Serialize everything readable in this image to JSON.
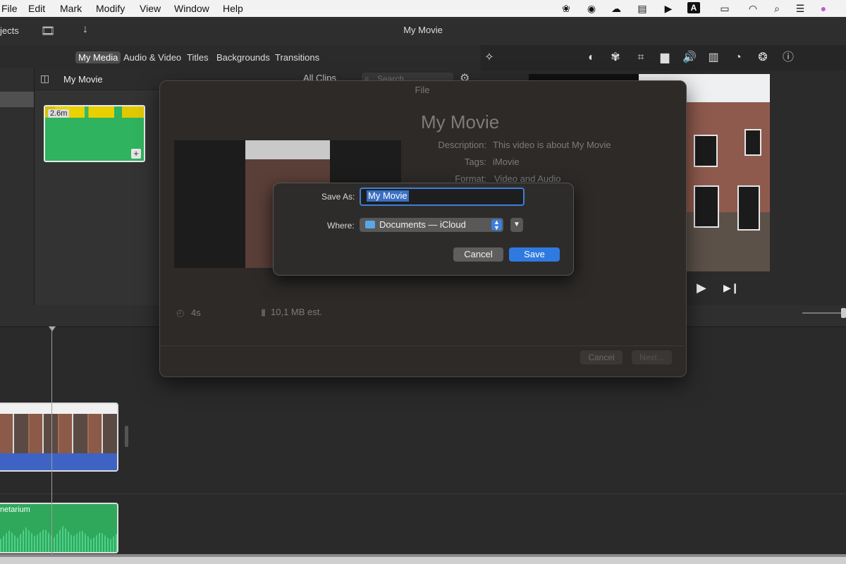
{
  "menubar": {
    "items": [
      "File",
      "Edit",
      "Mark",
      "Modify",
      "View",
      "Window",
      "Help"
    ],
    "tray_icons": [
      "lotus-icon",
      "record-icon",
      "creative-cloud-icon",
      "drive-icon",
      "play-circle-icon",
      "input-source-icon",
      "battery-icon",
      "wifi-icon",
      "search-icon",
      "control-center-icon",
      "siri-icon"
    ],
    "input_source_letter": "A"
  },
  "toolbar": {
    "projects_label": "jects",
    "window_title": "My Movie"
  },
  "browser_tabs": [
    "My Media",
    "Audio & Video",
    "Titles",
    "Backgrounds",
    "Transitions"
  ],
  "browser": {
    "title": "My Movie",
    "filter_label": "All Clips",
    "search_placeholder": "Search",
    "clip_duration": "2.6m"
  },
  "inspector_icons": [
    "magic-wand-icon",
    "color-balance-icon",
    "color-palette-icon",
    "crop-icon",
    "stabilization-icon",
    "volume-icon",
    "equalizer-icon",
    "speed-icon",
    "overlay-icon",
    "info-icon"
  ],
  "timeline": {
    "audio_clip_label": "netarium"
  },
  "share_sheet": {
    "title": "File",
    "movie_title": "My Movie",
    "description_label": "Description:",
    "description_value": "This video is about My Movie",
    "tags_label": "Tags:",
    "tags_value": "iMovie",
    "format_label": "Format:",
    "format_value": "Video and Audio",
    "duration": "4s",
    "size": "10,1 MB est.",
    "cancel_label": "Cancel",
    "next_label": "Next..."
  },
  "save_dialog": {
    "save_as_label": "Save As:",
    "save_as_value": "My Movie",
    "where_label": "Where:",
    "where_value": "Documents — iCloud",
    "cancel_label": "Cancel",
    "save_label": "Save"
  },
  "colors": {
    "accent": "#2f7ae0",
    "clip_green": "#2fb35e",
    "audio_blue": "#3f63c4"
  }
}
